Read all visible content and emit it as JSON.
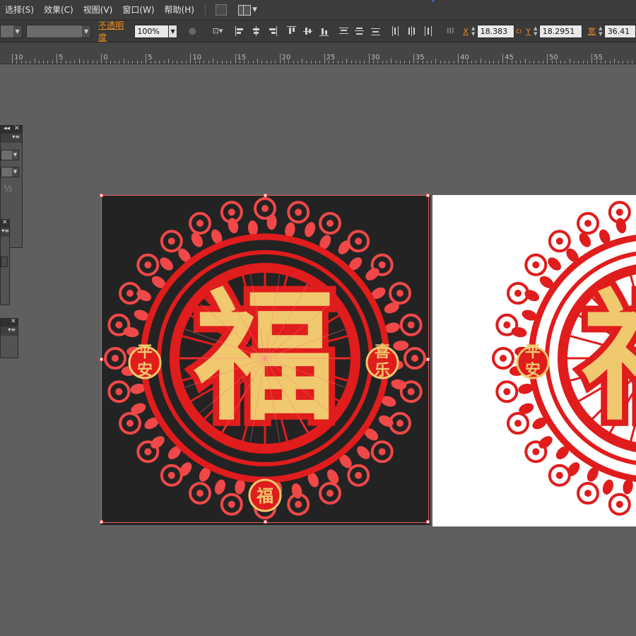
{
  "menu": {
    "items": [
      "选择(S)",
      "效果(C)",
      "视图(V)",
      "窗口(W)",
      "帮助(H)"
    ]
  },
  "control_bar": {
    "opacity_label": "不透明度",
    "opacity_value": "100%",
    "x_label": "X",
    "x_value": "18.383",
    "x_unit": "cı",
    "y_label": "Y",
    "y_value": "18.2951",
    "width_label": "宽",
    "width_value": "36.41"
  },
  "ruler": {
    "labels": [
      "10",
      "5",
      "0",
      "5",
      "10",
      "15",
      "20",
      "25",
      "30",
      "35",
      "40",
      "45",
      "50",
      "55"
    ]
  },
  "panels": {
    "half_glyph": "½"
  },
  "artwork": {
    "center_char": "福",
    "left_medallion": [
      "平",
      "安"
    ],
    "right_medallion": [
      "喜",
      "乐"
    ],
    "bottom_medallion": "福",
    "colors": {
      "red": "#e01c1c",
      "light_red": "#f04848",
      "gold": "#f0c86e",
      "dark_bg": "#232323"
    }
  }
}
